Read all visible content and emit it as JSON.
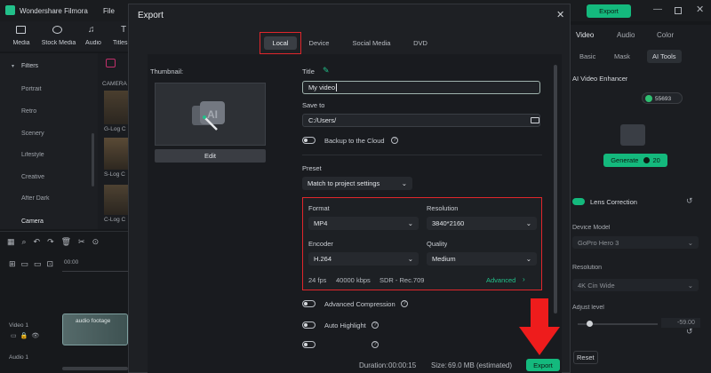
{
  "app": {
    "title": "Wondershare Filmora",
    "menu_file": "File",
    "export_button": "Export",
    "toolbar": [
      "Media",
      "Stock Media",
      "Audio",
      "Titles"
    ],
    "filters_label": "Filters",
    "filter_items": [
      "Portrait",
      "Retro",
      "Scenery",
      "Lifestyle",
      "Creative",
      "After Dark",
      "Camera"
    ],
    "camera_label": "CAMERA",
    "thumbs": [
      "G-Log C",
      "S-Log C",
      "C-Log C"
    ],
    "timeline_time": "00:00",
    "track_video": "Video 1",
    "track_audio": "Audio 1",
    "clip_name": "audio footage"
  },
  "right_panel": {
    "tabs": [
      "Video",
      "Audio",
      "Color"
    ],
    "subtabs": [
      "Basic",
      "Mask",
      "AI Tools"
    ],
    "enhancer_title": "AI Video Enhancer",
    "credits": "55693",
    "generate_label": "Generate",
    "generate_cost": "20",
    "lens_label": "Lens Correction",
    "device_model_label": "Device Model",
    "device_model_value": "GoPro Hero 3",
    "resolution_label": "Resolution",
    "resolution_value": "4K Cin Wide",
    "adjust_label": "Adjust level",
    "adjust_value": "-59.00",
    "reset_label": "Reset"
  },
  "modal": {
    "title": "Export",
    "tabs": [
      "Local",
      "Device",
      "Social Media",
      "DVD"
    ],
    "thumbnail_label": "Thumbnail:",
    "edit_label": "Edit",
    "title_label": "Title",
    "title_value": "My video",
    "save_to_label": "Save to",
    "save_to_value": "C:/Users/",
    "backup_label": "Backup to the Cloud",
    "preset_label": "Preset",
    "preset_value": "Match to project settings",
    "format_label": "Format",
    "format_value": "MP4",
    "resolution_label": "Resolution",
    "resolution_value": "3840*2160",
    "encoder_label": "Encoder",
    "encoder_value": "H.264",
    "quality_label": "Quality",
    "quality_value": "Medium",
    "fps": "24 fps",
    "bitrate": "40000 kbps",
    "color": "SDR - Rec.709",
    "advanced_label": "Advanced",
    "adv_compression_label": "Advanced Compression",
    "auto_highlight_label": "Auto Highlight",
    "duration_label": "Duration:",
    "duration_value": "00:00:15",
    "size_label": "Size:",
    "size_value": "69.0 MB (estimated)",
    "export_label": "Export"
  },
  "colors": {
    "accent_green": "#14b97d",
    "highlight_red": "#e0262b",
    "arrow_red": "#ee1c1c"
  }
}
